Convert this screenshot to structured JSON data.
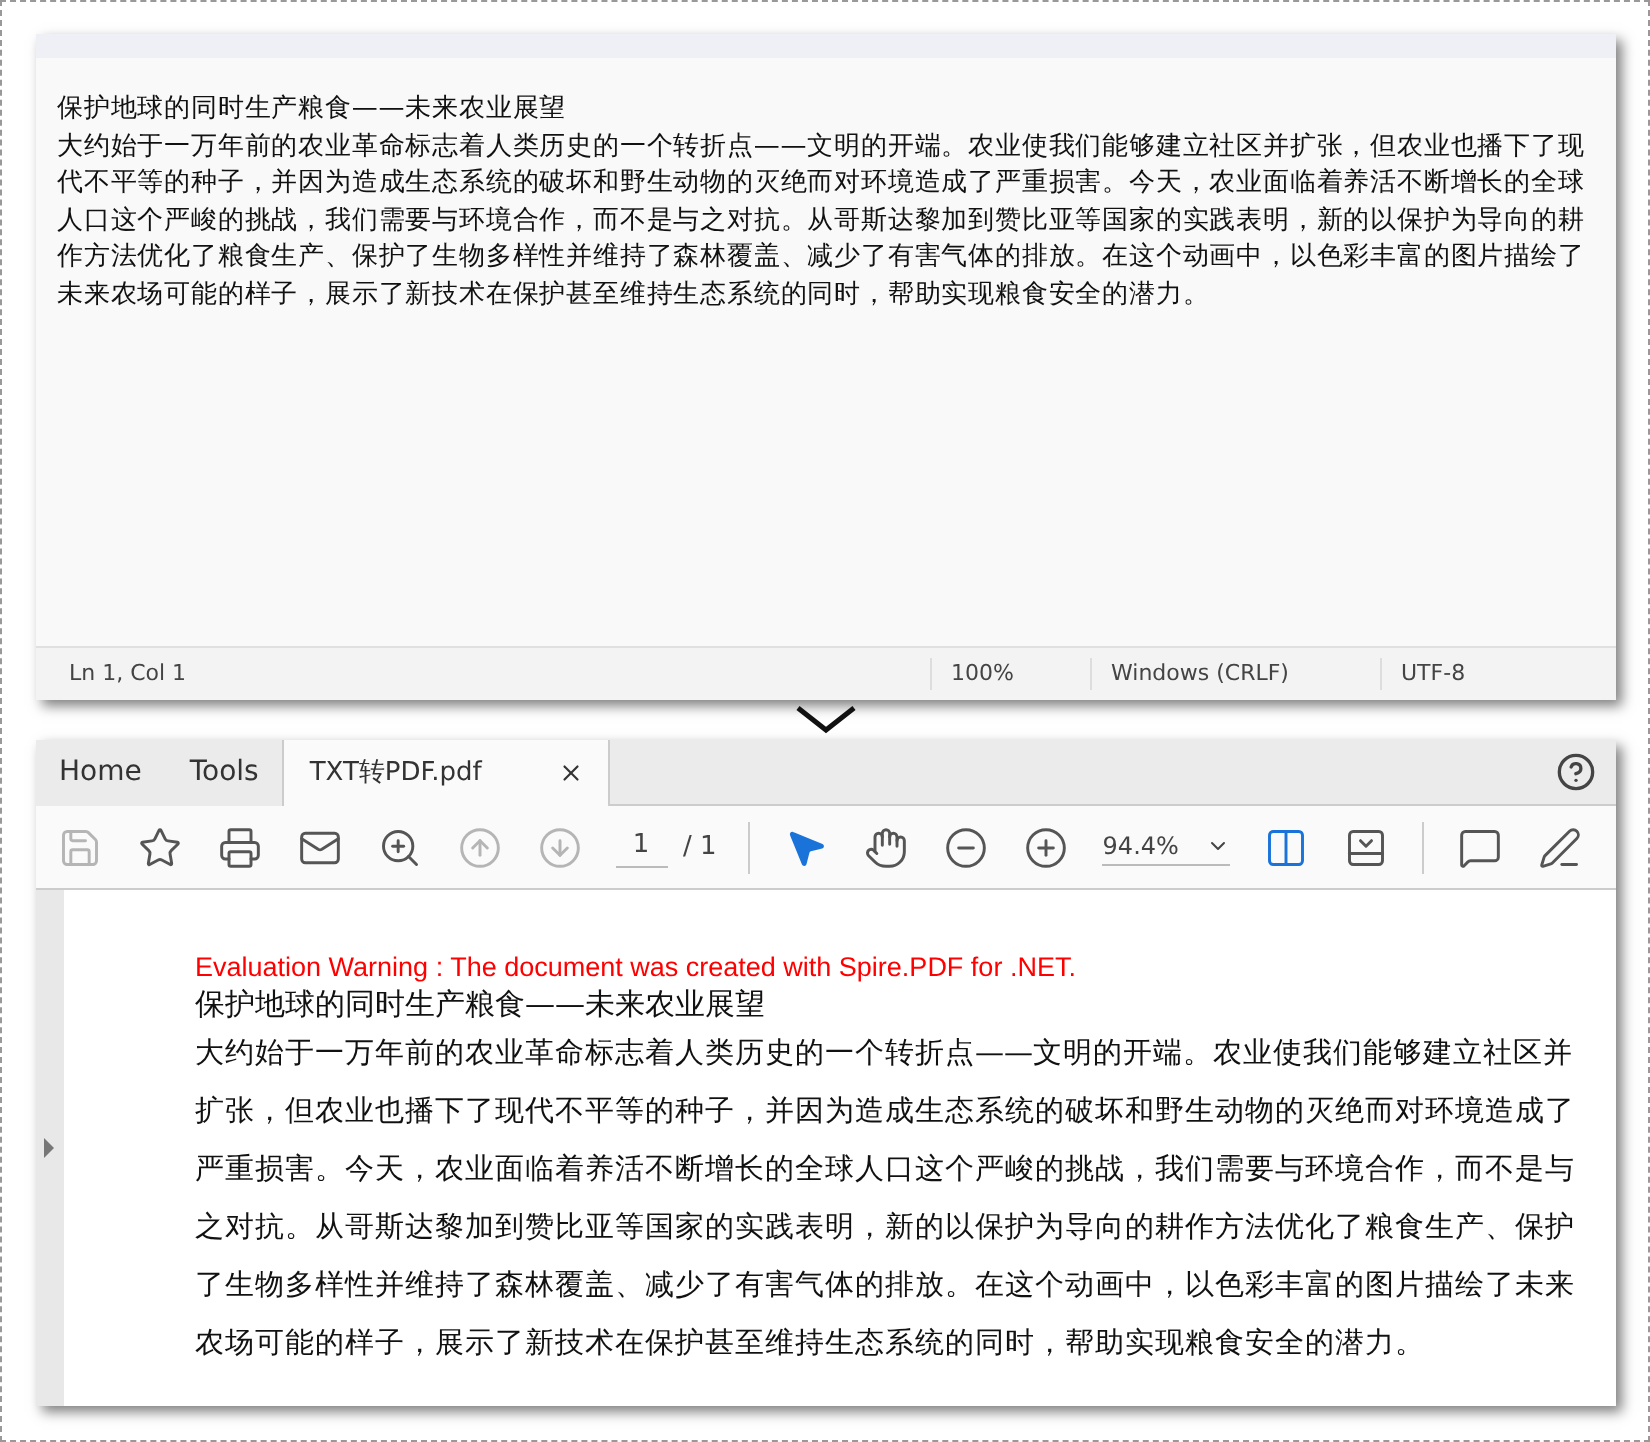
{
  "editor": {
    "lines": [
      "保护地球的同时生产粮食——未来农业展望",
      "大约始于一万年前的农业革命标志着人类历史的一个转折点——文明的开端。农业使我们能够建立社区并扩张，但农业也播下了现",
      "代不平等的种子，并因为造成生态系统的破坏和野生动物的灭绝而对环境造成了严重损害。今天，农业面临着养活不断增长的全球",
      "人口这个严峻的挑战，我们需要与环境合作，而不是与之对抗。从哥斯达黎加到赞比亚等国家的实践表明，新的以保护为导向的耕",
      "作方法优化了粮食生产、保护了生物多样性并维持了森林覆盖、减少了有害气体的排放。在这个动画中，以色彩丰富的图片描绘了",
      "未来农场可能的样子，展示了新技术在保护甚至维持生态系统的同时，帮助实现粮食安全的潜力。"
    ],
    "status": {
      "position": "Ln 1, Col 1",
      "zoom": "100%",
      "line_ending": "Windows (CRLF)",
      "encoding": "UTF-8"
    }
  },
  "viewer": {
    "tabs": [
      {
        "label": "Home",
        "selected": false
      },
      {
        "label": "Tools",
        "selected": false
      },
      {
        "label": "TXT转PDF.pdf",
        "selected": true
      }
    ],
    "toolbar": [
      {
        "kind": "save",
        "disabled": true
      },
      {
        "kind": "star",
        "disabled": false
      },
      {
        "kind": "print",
        "disabled": false
      },
      {
        "kind": "mail",
        "disabled": false
      },
      {
        "kind": "search",
        "disabled": false
      },
      {
        "kind": "up",
        "disabled": true
      },
      {
        "kind": "down",
        "disabled": true
      },
      {
        "kind": "page"
      },
      {
        "kind": "pointer",
        "disabled": false
      },
      {
        "kind": "hand",
        "disabled": false
      },
      {
        "kind": "zoom-out",
        "disabled": false
      },
      {
        "kind": "zoom-in",
        "disabled": false
      },
      {
        "kind": "zoom-level"
      },
      {
        "kind": "fit",
        "disabled": false
      },
      {
        "kind": "scroll",
        "disabled": false
      },
      {
        "kind": "comment",
        "disabled": false
      },
      {
        "kind": "pen",
        "disabled": false
      }
    ],
    "page": {
      "current": "1",
      "total": "/ 1"
    },
    "zoom": "94.4%",
    "document": {
      "warning": "Evaluation Warning : The document was created with Spire.PDF for .NET.",
      "title": "保护地球的同时生产粮食——未来农业展望",
      "lines": [
        "大约始于一万年前的农业革命标志着人类历史的一个转折点——文明的开端。农业使我们能够建立社区并",
        "扩张，但农业也播下了现代不平等的种子，并因为造成生态系统的破坏和野生动物的灭绝而对环境造成了",
        "严重损害。今天，农业面临着养活不断增长的全球人口这个严峻的挑战，我们需要与环境合作，而不是与",
        "之对抗。从哥斯达黎加到赞比亚等国家的实践表明，新的以保护为导向的耕作方法优化了粮食生产、保护",
        "了生物多样性并维持了森林覆盖、减少了有害气体的排放。在这个动画中，以色彩丰富的图片描绘了未来",
        "农场可能的样子，展示了新技术在保护甚至维持生态系统的同时，帮助实现粮食安全的潜力。"
      ]
    }
  }
}
